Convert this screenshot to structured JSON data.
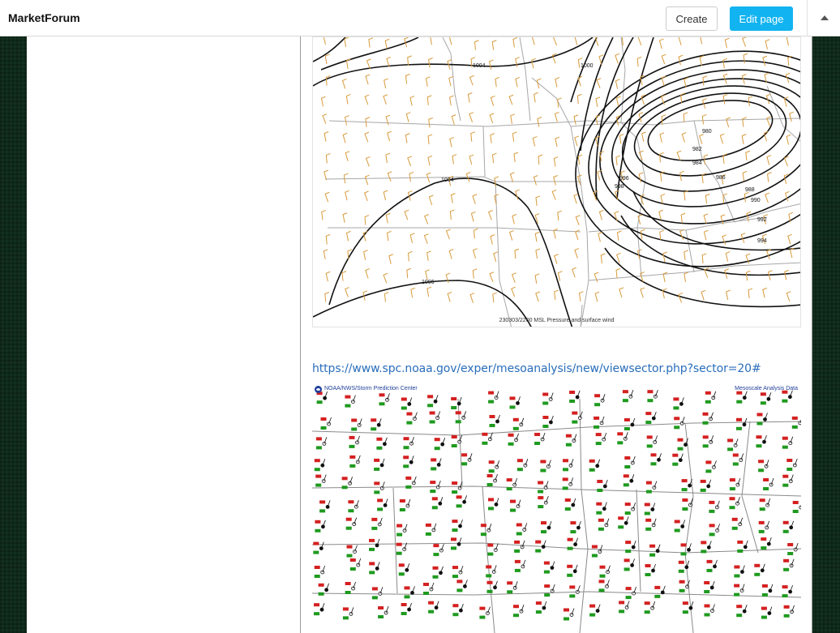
{
  "header": {
    "brand": "MarketForum",
    "create_label": "Create",
    "edit_label": "Edit page"
  },
  "surface_map": {
    "caption": "230303/2200 MSL Pressure and surface wind",
    "isobar_labels": [
      "1004",
      "1000",
      "980",
      "982",
      "984",
      "986",
      "988",
      "990",
      "992",
      "994",
      "996",
      "998",
      "1004",
      "1006"
    ]
  },
  "link": {
    "text": "https://www.spc.noaa.gov/exper/mesoanalysis/new/viewsector.php?sector=20#"
  },
  "mesoanalysis": {
    "left_title": "NOAA/NWS/Storm Prediction Center",
    "right_title": "Mesoscale Analysis Data"
  },
  "colors": {
    "accent": "#11b3f0",
    "link": "#2a6ebb",
    "wind_barb": "#d89a3a",
    "temperature": "#d42020",
    "dewpoint": "#1f9a1f"
  }
}
